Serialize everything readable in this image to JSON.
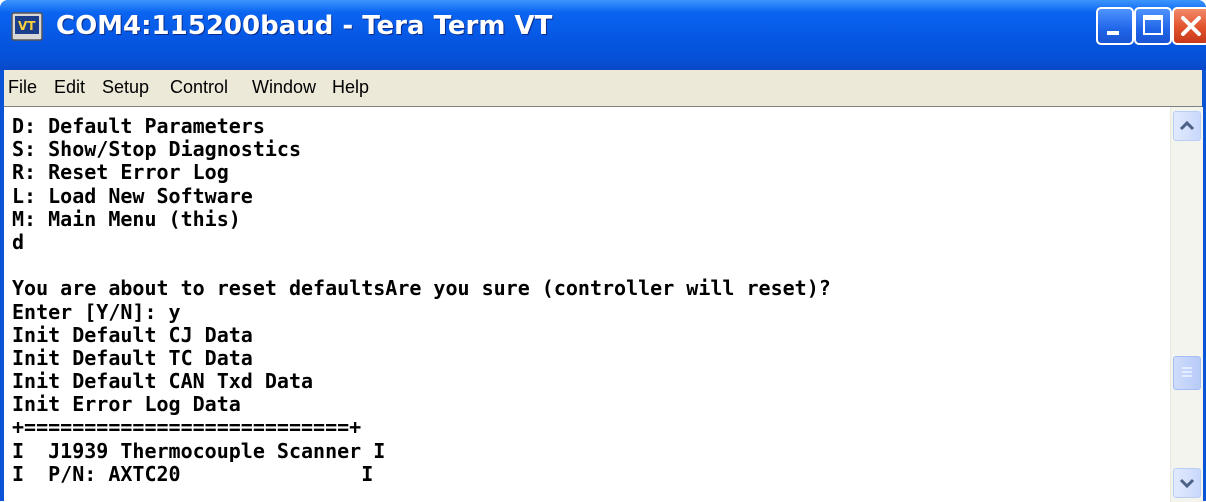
{
  "window": {
    "title": "COM4:115200baud - Tera Term VT",
    "app_icon": "tera-term-icon",
    "buttons": [
      "minimize-icon",
      "maximize-icon",
      "close-icon"
    ]
  },
  "menu": {
    "items": [
      {
        "label": "File"
      },
      {
        "label": "Edit"
      },
      {
        "label": "Setup"
      },
      {
        "label": "Control"
      },
      {
        "label": "Window"
      },
      {
        "label": "Help"
      }
    ]
  },
  "terminal": {
    "lines": [
      "D: Default Parameters",
      "S: Show/Stop Diagnostics",
      "R: Reset Error Log",
      "L: Load New Software",
      "M: Main Menu (this)",
      "d",
      "",
      "You are about to reset defaultsAre you sure (controller will reset)?",
      "Enter [Y/N]: y",
      "Init Default CJ Data",
      "Init Default TC Data",
      "Init Default CAN Txd Data",
      "Init Error Log Data",
      "+===========================+",
      "I  J1939 Thermocouple Scanner I",
      "I  P/N: AXTC20               I"
    ]
  },
  "scrollbar": {
    "up_icon": "scroll-up-arrow-icon",
    "down_icon": "scroll-down-arrow-icon"
  }
}
